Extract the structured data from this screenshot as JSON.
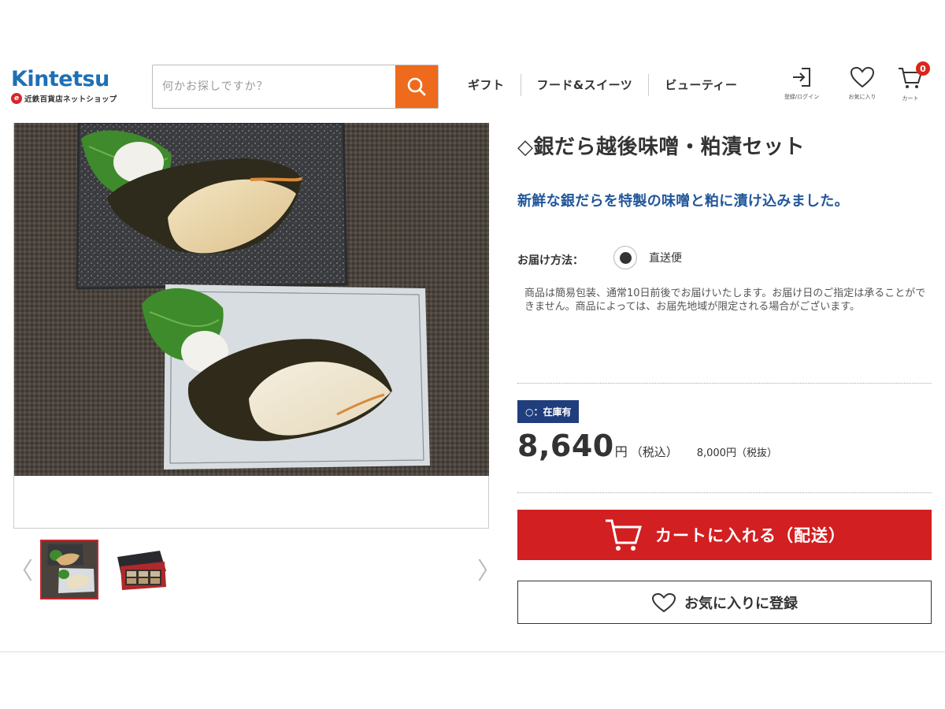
{
  "header": {
    "logo_main": "Kintetsu",
    "logo_sub": "近鉄百貨店ネットショップ",
    "search_placeholder": "何かお探しですか？",
    "nav": [
      "ギフト",
      "フード&スイーツ",
      "ビューティー"
    ],
    "util": {
      "login_label": "登録/ログイン",
      "fav_label": "お気に入り",
      "cart_label": "カート",
      "cart_count": "0"
    },
    "colors": {
      "search_button": "#ee6a1d",
      "logo": "#1f6fb5",
      "cart_badge": "#d9261c"
    }
  },
  "gallery": {
    "prev_arrow": "〈",
    "next_arrow": "〉",
    "thumbnails": [
      "fish-dish-thumbnail",
      "gift-box-thumbnail"
    ]
  },
  "product": {
    "title": "◇銀だら越後味噌・粕漬セット",
    "catch_copy": "新鮮な銀だらを特製の味噌と粕に漬け込みました。",
    "delivery_label": "お届け方法：",
    "delivery_option": "直送便",
    "notice": "商品は簡易包装、通常10日前後でお届けいたします。お届け日のご指定は承ることができません。商品によっては、お届先地域が限定される場合がございます。",
    "stock": "○：在庫有",
    "price": "8,640",
    "price_unit": "円",
    "price_tax": "（税込）",
    "price_ex_tax": "8,000円（税抜）",
    "cart_button": "カートに入れる（配送）",
    "favorite_button": "お気に入りに登録",
    "colors": {
      "title_catch": "#22579a",
      "stock_badge": "#203e7d",
      "cart_button": "#d21f21"
    }
  }
}
